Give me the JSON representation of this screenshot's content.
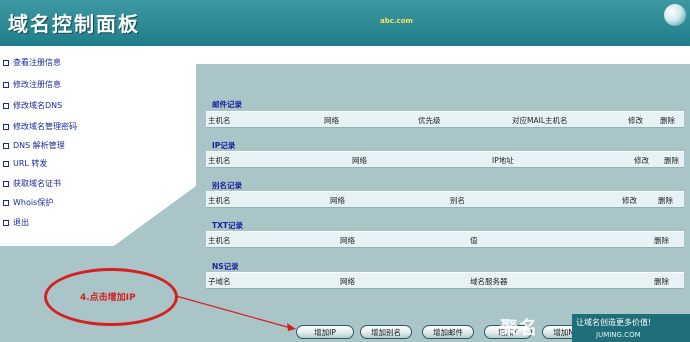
{
  "header": {
    "title": "域名控制面板",
    "domain": "abc.com"
  },
  "sidebar": {
    "items": [
      {
        "label": "查看注册信息"
      },
      {
        "label": "修改注册信息"
      },
      {
        "label": "修改域名DNS"
      },
      {
        "label": "修改域名管理密码"
      },
      {
        "label": "DNS 解析管理"
      },
      {
        "label": "URL 转发"
      },
      {
        "label": "获取域名证书"
      },
      {
        "label": "Whois保护"
      },
      {
        "label": "退出"
      }
    ]
  },
  "sections": {
    "mx": {
      "title": "邮件记录",
      "headers": [
        "主机名",
        "网络",
        "优先级",
        "对应MAIL主机名",
        "修改",
        "删除"
      ]
    },
    "a": {
      "title": "IP记录",
      "headers": [
        "主机名",
        "网络",
        "IP地址",
        "修改",
        "删除"
      ]
    },
    "cname": {
      "title": "别名记录",
      "headers": [
        "主机名",
        "网络",
        "别名",
        "修改",
        "删除"
      ]
    },
    "txt": {
      "title": "TXT记录",
      "headers": [
        "主机名",
        "网络",
        "值",
        "删除"
      ]
    },
    "ns": {
      "title": "NS记录",
      "headers": [
        "子域名",
        "网络",
        "域名服务器",
        "删除"
      ]
    }
  },
  "buttons": {
    "add_ip": "增加IP",
    "add_alias": "增加别名",
    "add_mail": "增加邮件",
    "add_txt": "增加T",
    "add_ns": "增加NS"
  },
  "annotation": {
    "text": "4.点击增加IP",
    "color": "#d62020"
  },
  "watermark": {
    "text": "聚名",
    "slogan": "让域名创造更多价值!",
    "site": "JUMING.COM"
  }
}
